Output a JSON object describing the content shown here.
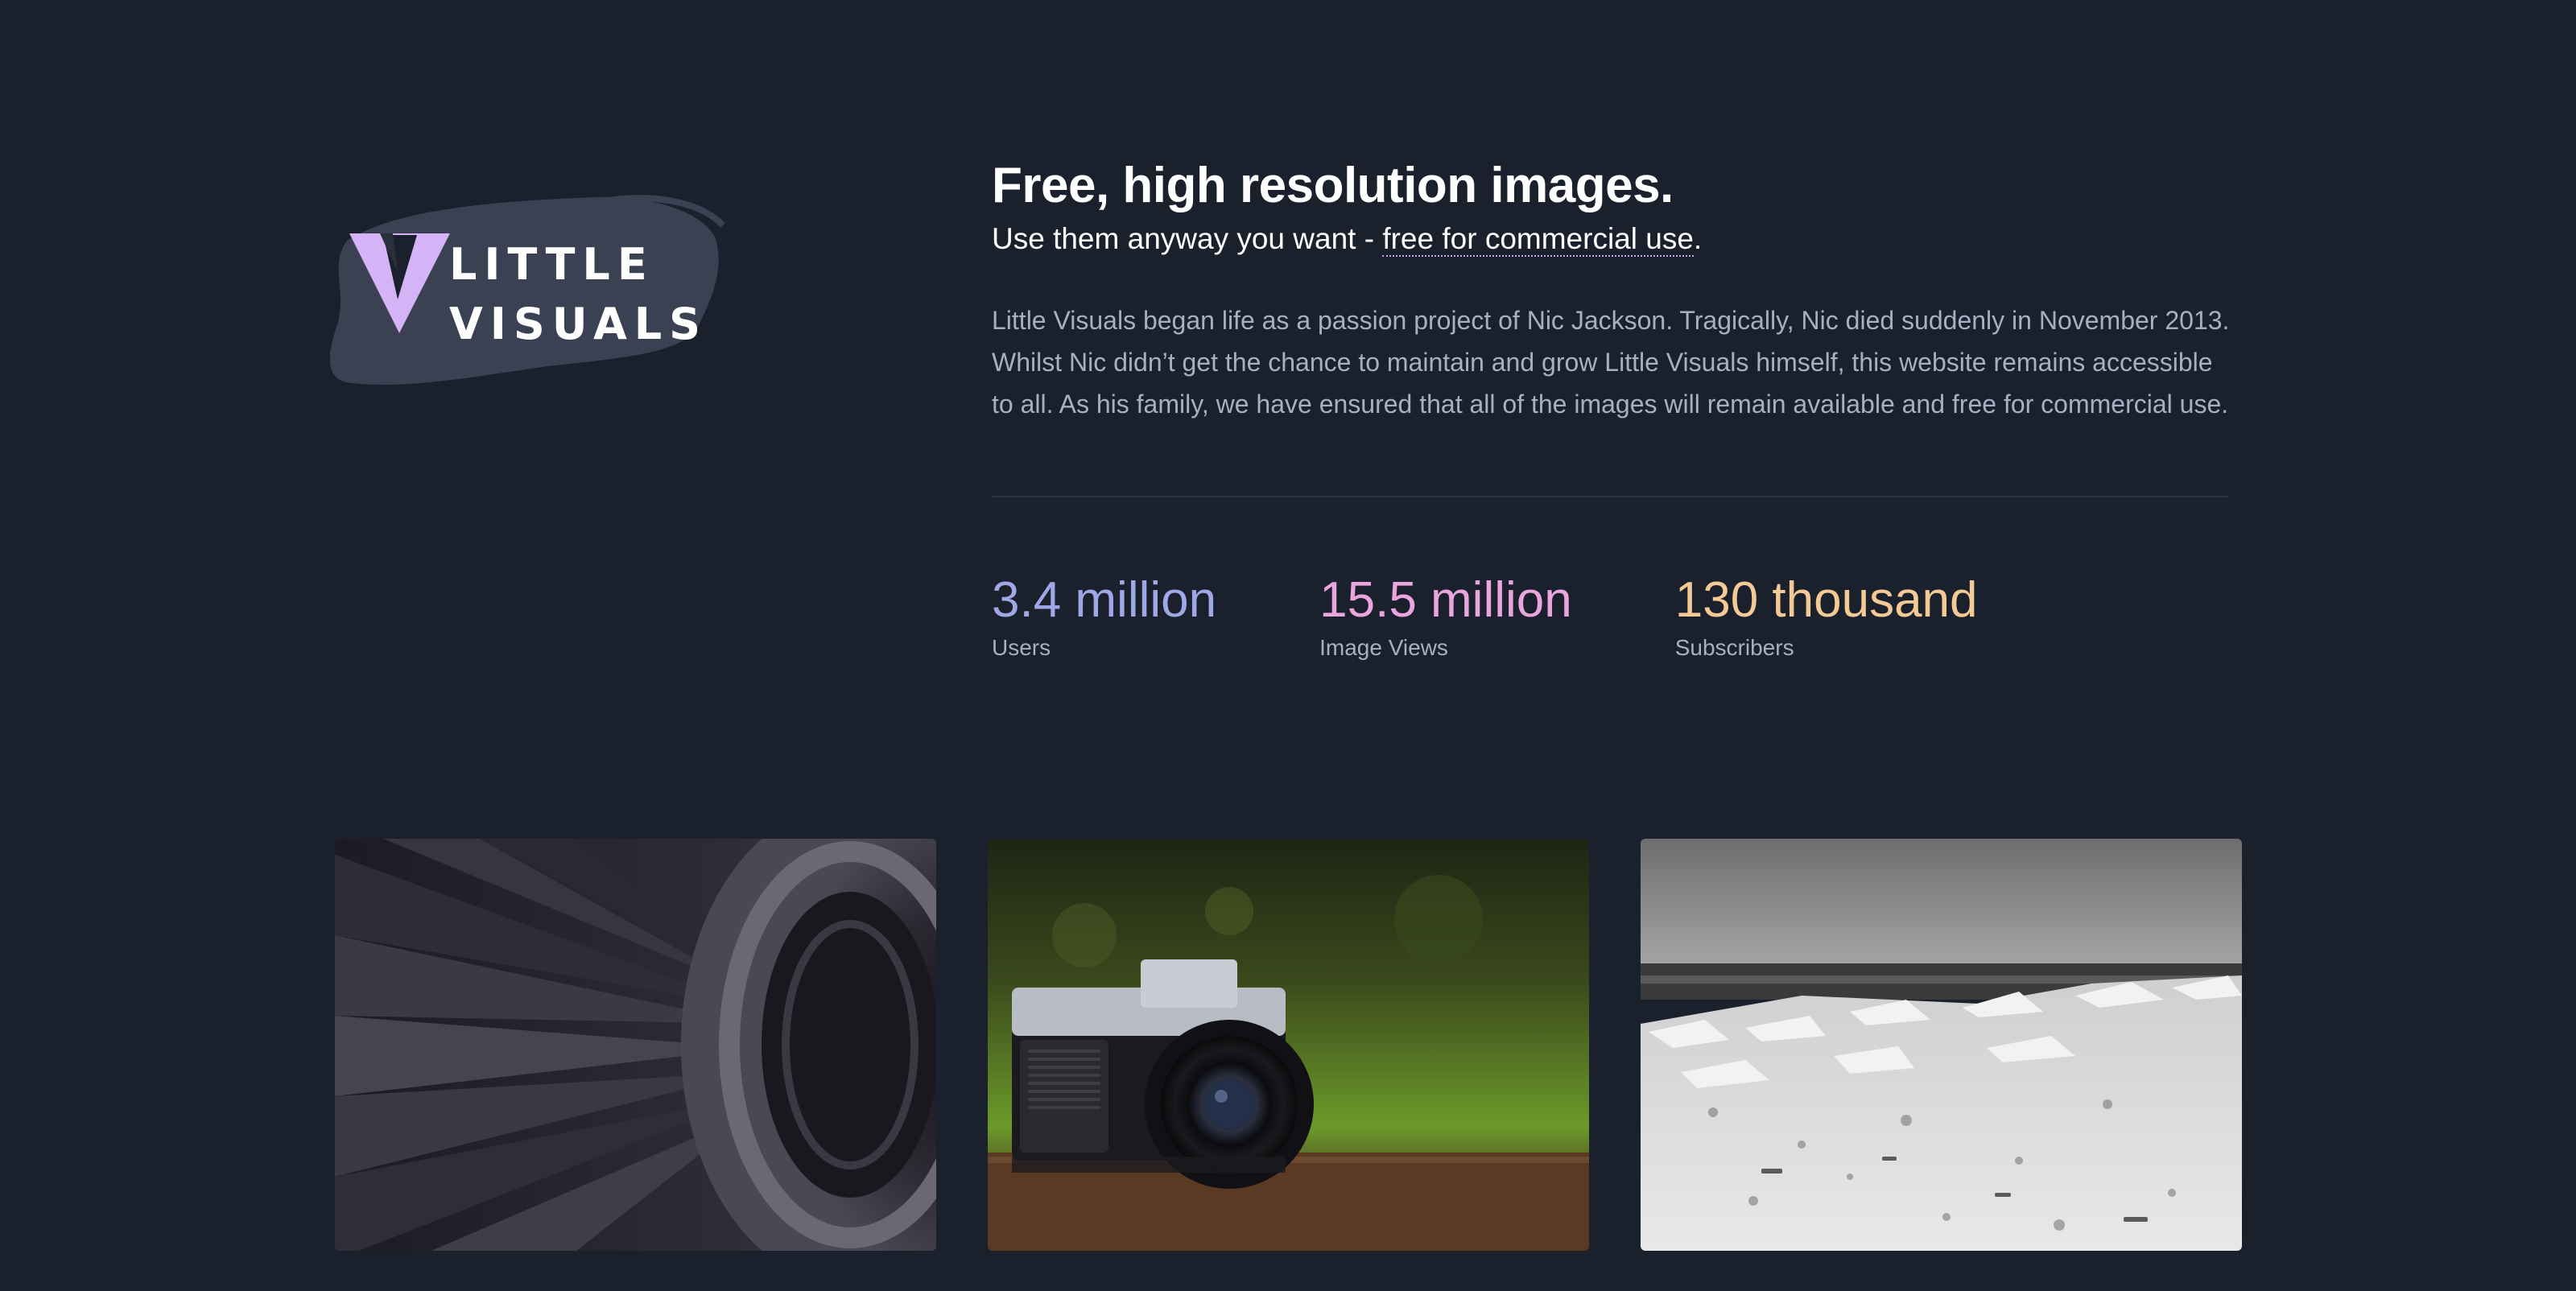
{
  "brand": {
    "name_line1": "LITTLE",
    "name_line2": "VISUALS",
    "accent_color": "#d4b3f7"
  },
  "intro": {
    "headline": "Free, high resolution images.",
    "sub_prefix": "Use them anyway you want - ",
    "sub_link": "free for commercial use",
    "sub_suffix": ".",
    "bio": "Little Visuals began life as a passion project of Nic Jackson. Tragically, Nic died suddenly in November 2013. Whilst Nic didn’t get the chance to maintain and grow Little Visuals himself, this website remains accessible to all. As his family, we have ensured that all of the images will remain available and free for commercial use."
  },
  "stats": [
    {
      "value": "3.4 million",
      "label": "Users",
      "color": "#9fa8e6"
    },
    {
      "value": "15.5 million",
      "label": "Image Views",
      "color": "#e9a6de"
    },
    {
      "value": "130 thousand",
      "label": "Subscribers",
      "color": "#f3c996"
    }
  ],
  "photos": [
    {
      "subject": "jet-engine-fan"
    },
    {
      "subject": "canon-camera"
    },
    {
      "subject": "icy-beach"
    }
  ]
}
